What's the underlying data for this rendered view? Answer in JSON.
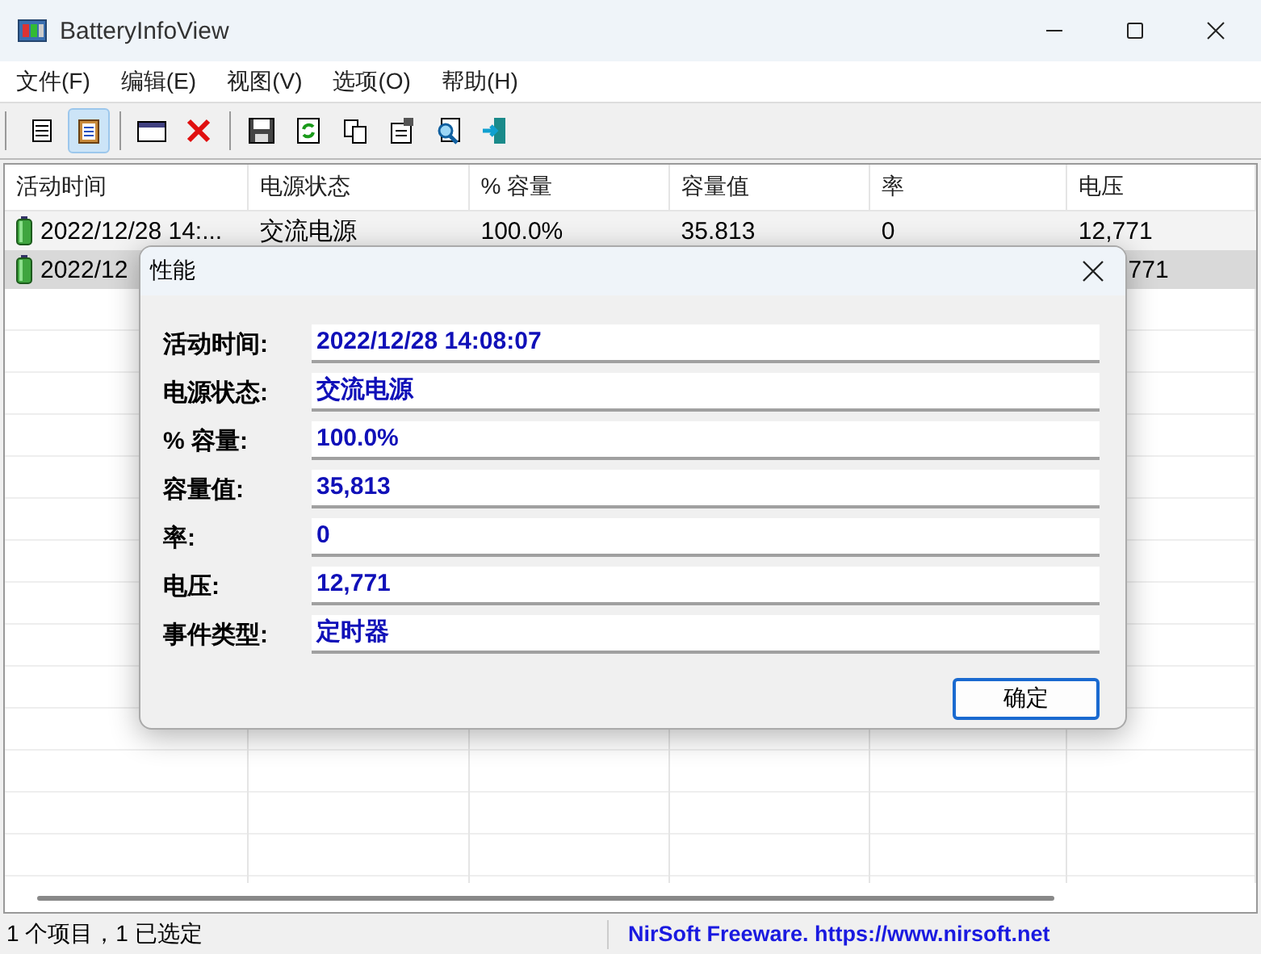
{
  "window": {
    "title": "BatteryInfoView"
  },
  "menu": [
    "文件(F)",
    "编辑(E)",
    "视图(V)",
    "选项(O)",
    "帮助(H)"
  ],
  "toolbar": [
    {
      "kind": "properties",
      "pressed": false
    },
    {
      "kind": "clipboard",
      "pressed": true
    },
    {
      "kind": "sep"
    },
    {
      "kind": "window",
      "pressed": false
    },
    {
      "kind": "delete",
      "pressed": false
    },
    {
      "kind": "sep"
    },
    {
      "kind": "save",
      "pressed": false
    },
    {
      "kind": "refresh",
      "pressed": false
    },
    {
      "kind": "copy",
      "pressed": false
    },
    {
      "kind": "report",
      "pressed": false
    },
    {
      "kind": "find",
      "pressed": false
    },
    {
      "kind": "exit",
      "pressed": false
    }
  ],
  "table": {
    "columns": [
      "活动时间",
      "电源状态",
      "% 容量",
      "容量值",
      "率",
      "电压"
    ],
    "rows": [
      {
        "selected": false,
        "cells": [
          "2022/12/28 14:...",
          "交流电源",
          "100.0%",
          "35.813",
          "0",
          "12,771"
        ]
      },
      {
        "selected": true,
        "cells": [
          "2022/12",
          null,
          null,
          null,
          null,
          "771"
        ]
      }
    ]
  },
  "dialog": {
    "title": "性能",
    "fields": [
      {
        "label": "活动时间:",
        "value": "2022/12/28 14:08:07"
      },
      {
        "label": "电源状态:",
        "value": "交流电源"
      },
      {
        "label": "% 容量:",
        "value": "100.0%"
      },
      {
        "label": "容量值:",
        "value": "35,813"
      },
      {
        "label": "率:",
        "value": "0"
      },
      {
        "label": "电压:",
        "value": "12,771"
      },
      {
        "label": "事件类型:",
        "value": "定时器"
      }
    ],
    "ok_button": "确定"
  },
  "status_bar": {
    "items": "1 个项目，1 已选定",
    "credit": "NirSoft Freeware. https://www.nirsoft.net"
  }
}
